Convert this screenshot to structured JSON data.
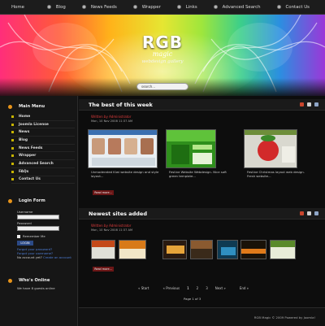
{
  "nav": {
    "items": [
      "Home",
      "Blog",
      "News Feeds",
      "Wrapper",
      "Links",
      "Advanced Search",
      "Contact Us"
    ]
  },
  "header": {
    "logo_main": "RGB",
    "logo_sub": "magic",
    "logo_tagline": "webdesign gallery",
    "search_placeholder": "search..."
  },
  "sidebar": {
    "main_menu_title": "Main Menu",
    "menu_items": [
      "Home",
      "Joomla License",
      "News",
      "Blog",
      "News Feeds",
      "Wrapper",
      "Advanced Search",
      "FAQs",
      "Contact Us"
    ],
    "login": {
      "title": "Login Form",
      "username_label": "Username",
      "password_label": "Password",
      "remember_label": "Remember Me",
      "login_button": "LOGIN",
      "forgot_password": "Forgot your password?",
      "forgot_username": "Forgot your username?",
      "no_account": "No account yet?",
      "register": "Create an account"
    },
    "whos_online": {
      "title": "Who's Online",
      "text": "We have 8 guests online"
    }
  },
  "sections": {
    "best": {
      "title": "The best of this week",
      "author": "Written by Administrator",
      "date": "Mon, 10 Nov 2008 11:37 AM",
      "read_more": "Read more...",
      "captions": [
        "Unmoderated Kiwi website design and style layout...",
        "Festive Website Webdesign. Nice soft green template...",
        "Festive Christmas layout web design. Fresh website..."
      ]
    },
    "newest": {
      "title": "Newest sites added",
      "author": "Written by Administrator",
      "date": "Mon, 10 Nov 2008 11:37 AM",
      "read_more": "Read more..."
    }
  },
  "pager": {
    "start": "« Start",
    "prev": "« Previous",
    "pages": [
      "1",
      "2",
      "3"
    ],
    "next": "Next »",
    "end": "End »",
    "page_of": "Page 1 of 3"
  },
  "footer": {
    "text": "RGB Magic © 2009 Powered by Joomla!"
  },
  "colors": {
    "accent_orange": "#e8941a",
    "readmore_red": "#6b1616",
    "tag_red": "#e03c3c"
  }
}
